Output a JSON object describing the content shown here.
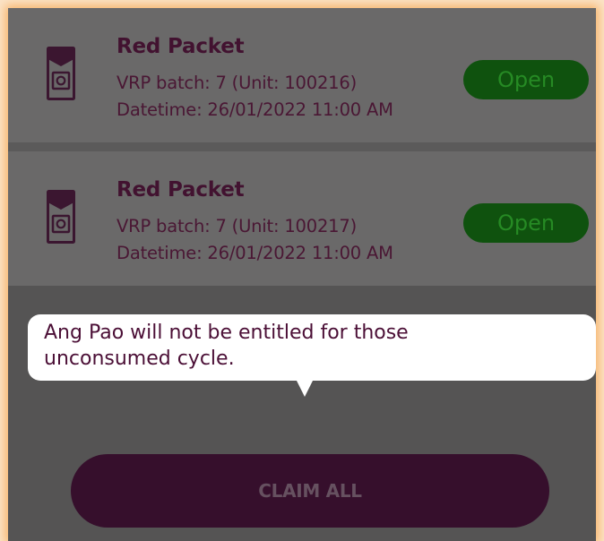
{
  "packets": [
    {
      "title": "Red Packet",
      "batch": "VRP batch: 7 (Unit: 100216)",
      "datetime": "Datetime: 26/01/2022 11:00 AM",
      "open_label": "Open"
    },
    {
      "title": "Red Packet",
      "batch": "VRP batch: 7 (Unit: 100217)",
      "datetime": "Datetime: 26/01/2022 11:00 AM",
      "open_label": "Open"
    }
  ],
  "tooltip": {
    "text": "Ang Pao will not be entitled for those unconsumed cycle."
  },
  "claim_all_label": "CLAIM ALL",
  "colors": {
    "overlay": "#555454",
    "card": "#6a6969",
    "brand_dark": "#360f2c",
    "open_green": "#0f520e",
    "frame_glow": "#f7b36a"
  },
  "icons": [
    "red-packet-envelope-icon"
  ]
}
